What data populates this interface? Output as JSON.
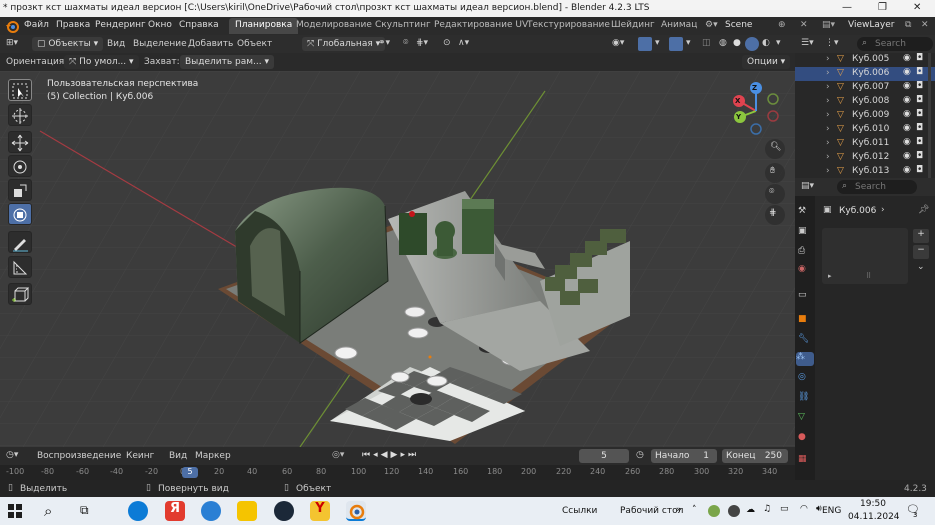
{
  "window": {
    "title": "* прозкт кст шахматы идеал версион [C:\\Users\\kiril\\OneDrive\\Рабочий стол\\прозкт кст шахматы идеал версион.blend] - Blender 4.2.3 LTS"
  },
  "menu": {
    "items": [
      "Файл",
      "Правка",
      "Рендеринг",
      "Окно",
      "Справка"
    ],
    "workspaces": [
      "Планировка",
      "Моделирование",
      "Скульптинг",
      "Редактирование UV",
      "Текстурирование",
      "Шейдинг",
      "Анимац"
    ],
    "active_workspace": "Планировка",
    "scene": "Scene",
    "view_layer": "ViewLayer"
  },
  "viewport_header": {
    "mode": "Объекты",
    "menus": [
      "Вид",
      "Выделение",
      "Добавить",
      "Объект"
    ],
    "transform_orientation": "Глобальная",
    "orientation_label": "Ориентация:",
    "orientation_value": "По умол...",
    "snap_label": "Захват:",
    "snap_value": "Выделить рам...",
    "options": "Опции"
  },
  "viewport": {
    "perspective": "Пользовательская перспектива",
    "collection": "(5) Collection | Куб.006",
    "gizmo": {
      "x": "X",
      "y": "Y",
      "z": "Z"
    }
  },
  "timeline": {
    "menus": [
      "Воспроизведение",
      "Кеинг",
      "Вид",
      "Маркер"
    ],
    "current_frame": "5",
    "start_label": "Начало",
    "start": "1",
    "end_label": "Конец",
    "end": "250",
    "ruler": [
      "-100",
      "-80",
      "-60",
      "-40",
      "-20",
      "0",
      "5",
      "20",
      "40",
      "60",
      "80",
      "100",
      "120",
      "140",
      "160",
      "180",
      "200",
      "220",
      "240",
      "260",
      "280",
      "300",
      "320",
      "340"
    ]
  },
  "status": {
    "select": "Выделить",
    "rotate": "Повернуть вид",
    "object": "Объект",
    "version": "4.2.3"
  },
  "outliner": {
    "search_placeholder": "Search",
    "items": [
      "Куб.005",
      "Куб.006",
      "Куб.007",
      "Куб.008",
      "Куб.009",
      "Куб.010",
      "Куб.011",
      "Куб.012",
      "Куб.013"
    ],
    "selected": "Куб.006"
  },
  "properties": {
    "search_placeholder": "Search",
    "object": "Куб.006"
  },
  "taskbar": {
    "links": "Ссылки",
    "desktop": "Рабочий стол",
    "lang": "ENG",
    "time": "19:50",
    "date": "04.11.2024",
    "notifications": "3"
  },
  "colors": {
    "accent_blue": "#4d6fa6",
    "axis_x": "#e0434f",
    "axis_y": "#8cc63e",
    "axis_z": "#4a8fe3",
    "blender_orange": "#e87d0d"
  }
}
